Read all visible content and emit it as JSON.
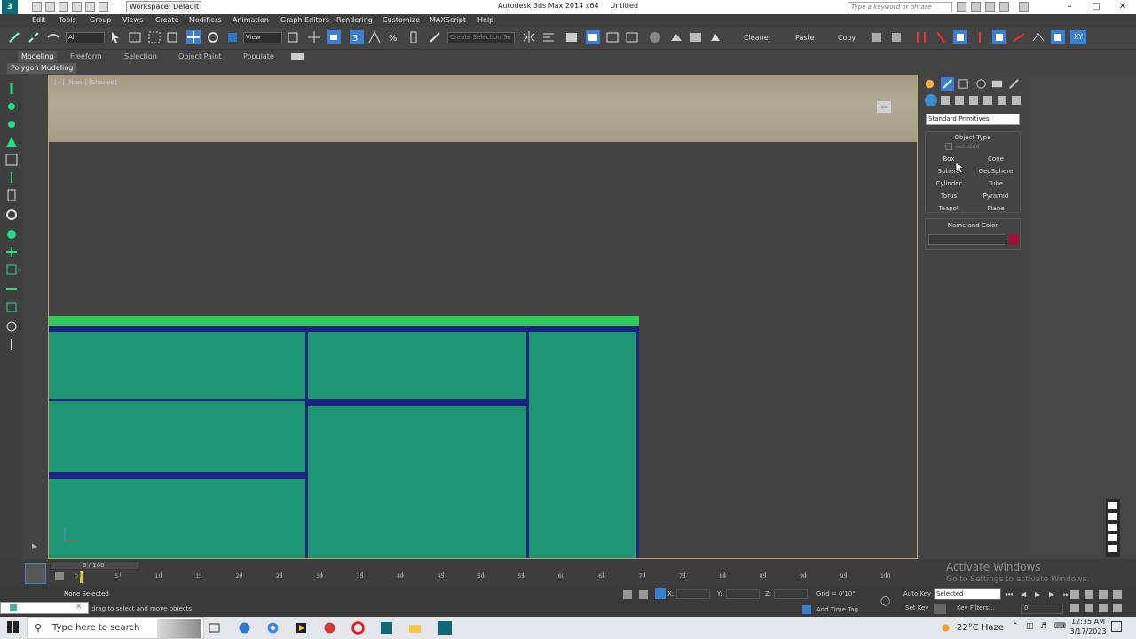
{
  "app": {
    "window_title": "Autodesk 3ds Max  2014 x64",
    "document": "Untitled",
    "workspace": "Workspace: Default",
    "search_placeholder": "Type a keyword or phrase"
  },
  "menu": [
    "Edit",
    "Tools",
    "Group",
    "Views",
    "Create",
    "Modifiers",
    "Animation",
    "Graph Editors",
    "Rendering",
    "Customize",
    "MAXScript",
    "Help"
  ],
  "toolbar": {
    "filter": "All",
    "ref_coord": "View",
    "selection_set": "Create Selection Se",
    "cleaner": "Cleaner",
    "paste": "Paste",
    "copy": "Copy"
  },
  "ribbon": {
    "tabs": [
      "Modeling",
      "Freeform",
      "Selection",
      "Object Paint",
      "Populate"
    ],
    "sub_label": "Polygon Modeling"
  },
  "viewport": {
    "label": "[+] [Front] [Shaded]",
    "viewcube": "front"
  },
  "command_panel": {
    "category": "Standard Primitives",
    "rollout_object_type": "Object Type",
    "autogrid": "AutoGrid",
    "buttons": [
      [
        "Box",
        "Cone"
      ],
      [
        "Sphere",
        "GeoSphere"
      ],
      [
        "Cylinder",
        "Tube"
      ],
      [
        "Torus",
        "Pyramid"
      ],
      [
        "Teapot",
        "Plane"
      ]
    ],
    "rollout_name_color": "Name and Color",
    "object_color": "#a0103a"
  },
  "timeline": {
    "frame": "0 / 100",
    "ticks": [
      "0",
      "5",
      "10",
      "15",
      "20",
      "25",
      "30",
      "35",
      "40",
      "45",
      "50",
      "55",
      "60",
      "65",
      "70",
      "75",
      "80",
      "85",
      "90",
      "95",
      "100"
    ]
  },
  "status": {
    "selection": "None Selected",
    "prompt": "Click or click-and-drag to select and move objects",
    "x_label": "X:",
    "y_label": "Y:",
    "z_label": "Z:",
    "grid": "Grid = 0'10\"",
    "add_time_tag": "Add Time Tag",
    "auto_key": "Auto Key",
    "set_key": "Set Key",
    "selected": "Selected",
    "key_filters": "Key Filters...",
    "frame_field": "0"
  },
  "watermark": {
    "title": "Activate Windows",
    "subtitle": "Go to Settings to activate Windows."
  },
  "taskbar": {
    "search": "Type here to search",
    "weather": "22°C  Haze",
    "time": "12:35 AM",
    "date": "3/17/2023"
  },
  "colors": {
    "cabinet_body": "#1f9673",
    "cabinet_edge": "#1a237e",
    "cabinet_top": "#2ecc55"
  }
}
